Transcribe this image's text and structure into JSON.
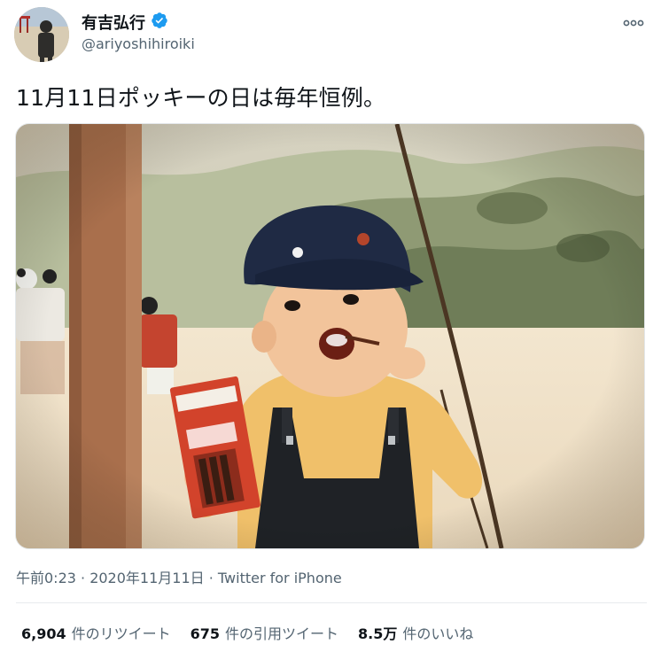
{
  "author": {
    "display_name": "有吉弘行",
    "handle": "@ariyoshihiroiki",
    "verified": true
  },
  "tweet": {
    "text": "11月11日ポッキーの日は毎年恒例。",
    "timestamp": "午前0:23 · 2020年11月11日",
    "separator": " · ",
    "source": "Twitter for iPhone"
  },
  "stats": {
    "retweets": {
      "count": "6,904",
      "label": "件のリツイート"
    },
    "quotes": {
      "count": "675",
      "label": "件の引用ツイート"
    },
    "likes": {
      "count": "8.5万",
      "label": "件のいいね"
    }
  },
  "colors": {
    "verified_badge": "#1d9bf0",
    "secondary_text": "#536471",
    "primary_text": "#0f1419"
  },
  "icons": {
    "verified": "verified-badge-icon",
    "more": "more-options-icon"
  }
}
